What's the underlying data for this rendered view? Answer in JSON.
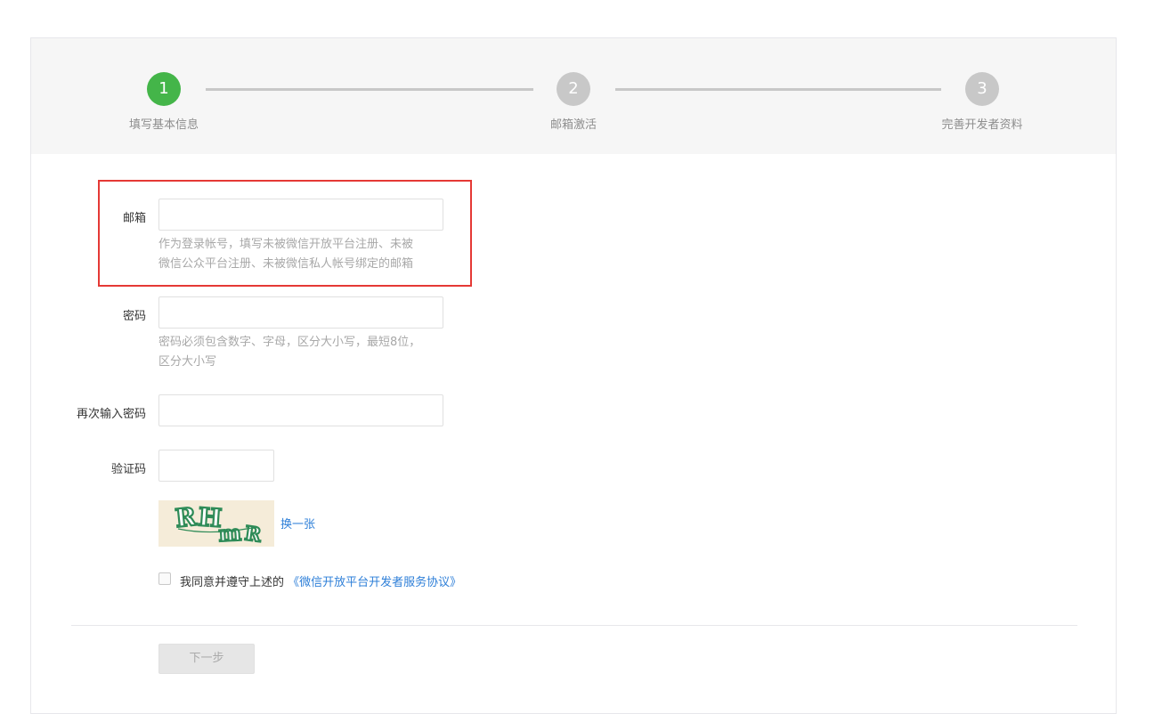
{
  "steps": [
    {
      "number": "1",
      "label": "填写基本信息",
      "status": "active"
    },
    {
      "number": "2",
      "label": "邮箱激活",
      "status": "inactive"
    },
    {
      "number": "3",
      "label": "完善开发者资料",
      "status": "inactive"
    }
  ],
  "form": {
    "email": {
      "label": "邮箱",
      "value": "",
      "tip_line1": "作为登录帐号，填写未被微信开放平台注册、未被",
      "tip_line2": "微信公众平台注册、未被微信私人帐号绑定的邮箱"
    },
    "password": {
      "label": "密码",
      "value": "",
      "tip_line1": "密码必须包含数字、字母，区分大小写，最短8位，",
      "tip_line2": "区分大小写"
    },
    "confirm_password": {
      "label": "再次输入密码",
      "value": ""
    },
    "captcha": {
      "label": "验证码",
      "value": "",
      "image_text": "RHmR",
      "refresh_link": "换一张"
    },
    "agreement": {
      "text": "我同意并遵守上述的",
      "link": "《微信开放平台开发者服务协议》",
      "checked": false
    },
    "next_button": "下一步"
  },
  "colors": {
    "active_step": "#44b549",
    "inactive_step": "#c8c8c8",
    "highlight": "#e53935",
    "link": "#2e7fd8"
  }
}
